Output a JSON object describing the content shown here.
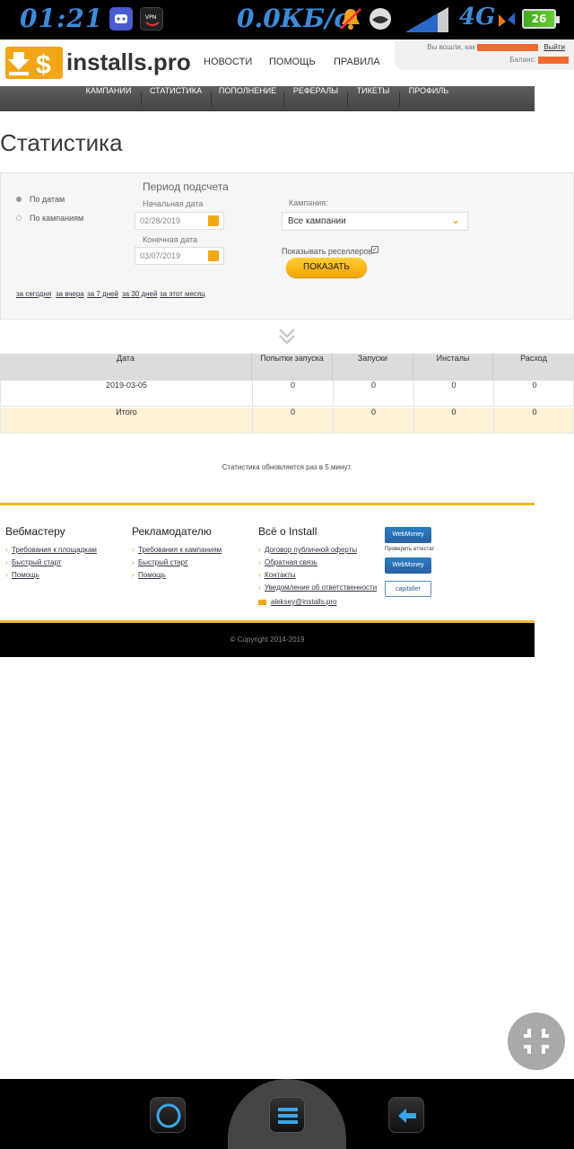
{
  "statusbar": {
    "time": "01:21",
    "speed": "0.0КБ/с",
    "network": "4G",
    "battery": "26",
    "icons": [
      "discord-icon",
      "vpn-icon",
      "notification-bell-icon",
      "whale-icon",
      "signal-icon",
      "sync-icon"
    ]
  },
  "header": {
    "logo_text": "installs.pro",
    "nav": [
      "НОВОСТИ",
      "ПОМОЩЬ",
      "ПРАВИЛА"
    ],
    "logged_in_label": "Вы вошли, как",
    "logout": "Выйти",
    "balance_label": "Баланс:"
  },
  "mainnav": [
    "КАМПАНИИ",
    "СТАТИСТИКА",
    "ПОПОЛНЕНИЕ",
    "РЕФЕРАЛЫ",
    "ТИКЕТЫ",
    "ПРОФИЛЬ"
  ],
  "page_title": "Статистика",
  "filter": {
    "radio_dates": "По датам",
    "radio_campaigns": "По кампаниям",
    "period_title": "Период подсчета",
    "start_label": "Начальная дата",
    "start_value": "02/28/2019",
    "end_label": "Конечная дата",
    "end_value": "03/07/2019",
    "campaign_label": "Кампания:",
    "campaign_value": "Все кампании",
    "resellers_label": "Показывать реселлеров:",
    "show_button": "ПОКАЗАТЬ",
    "quick_links": [
      "за сегодня",
      "за вчера",
      "за 7 дней",
      "за 30 дней",
      "за этот месяц"
    ]
  },
  "table": {
    "headers": [
      "Дата",
      "Попытки запуска",
      "Запуски",
      "Инсталы",
      "Расход"
    ],
    "rows": [
      [
        "2019-03-05",
        "0",
        "0",
        "0",
        "0"
      ]
    ],
    "total": [
      "Итого",
      "0",
      "0",
      "0",
      "0"
    ]
  },
  "note": "Статистика обновляется раз в 5 минут.",
  "footer": {
    "col1_title": "Вебмастеру",
    "col1_links": [
      "Требования к площадкам",
      "Быстрый старт",
      "Помощь"
    ],
    "col2_title": "Рекламодателю",
    "col2_links": [
      "Требования к кампаниям",
      "Быстрый старт",
      "Помощь"
    ],
    "col3_title": "Всё о Install",
    "col3_links": [
      "Договор публичной оферты",
      "Обратная связь",
      "Контакты",
      "Уведомление об ответственности"
    ],
    "email": "aleksey@installs.pro",
    "badge1": "WebMoney",
    "badge1_caption": "Проверить аттестат",
    "badge2": "WebMoney",
    "badge3": "capitaller",
    "copyright": "© Copyright 2014-2019"
  },
  "colors": {
    "accent": "#f2a516",
    "nav_bg": "#4e4e4e",
    "total_row": "#fdf1d6",
    "footer_line": "#f2b728"
  }
}
